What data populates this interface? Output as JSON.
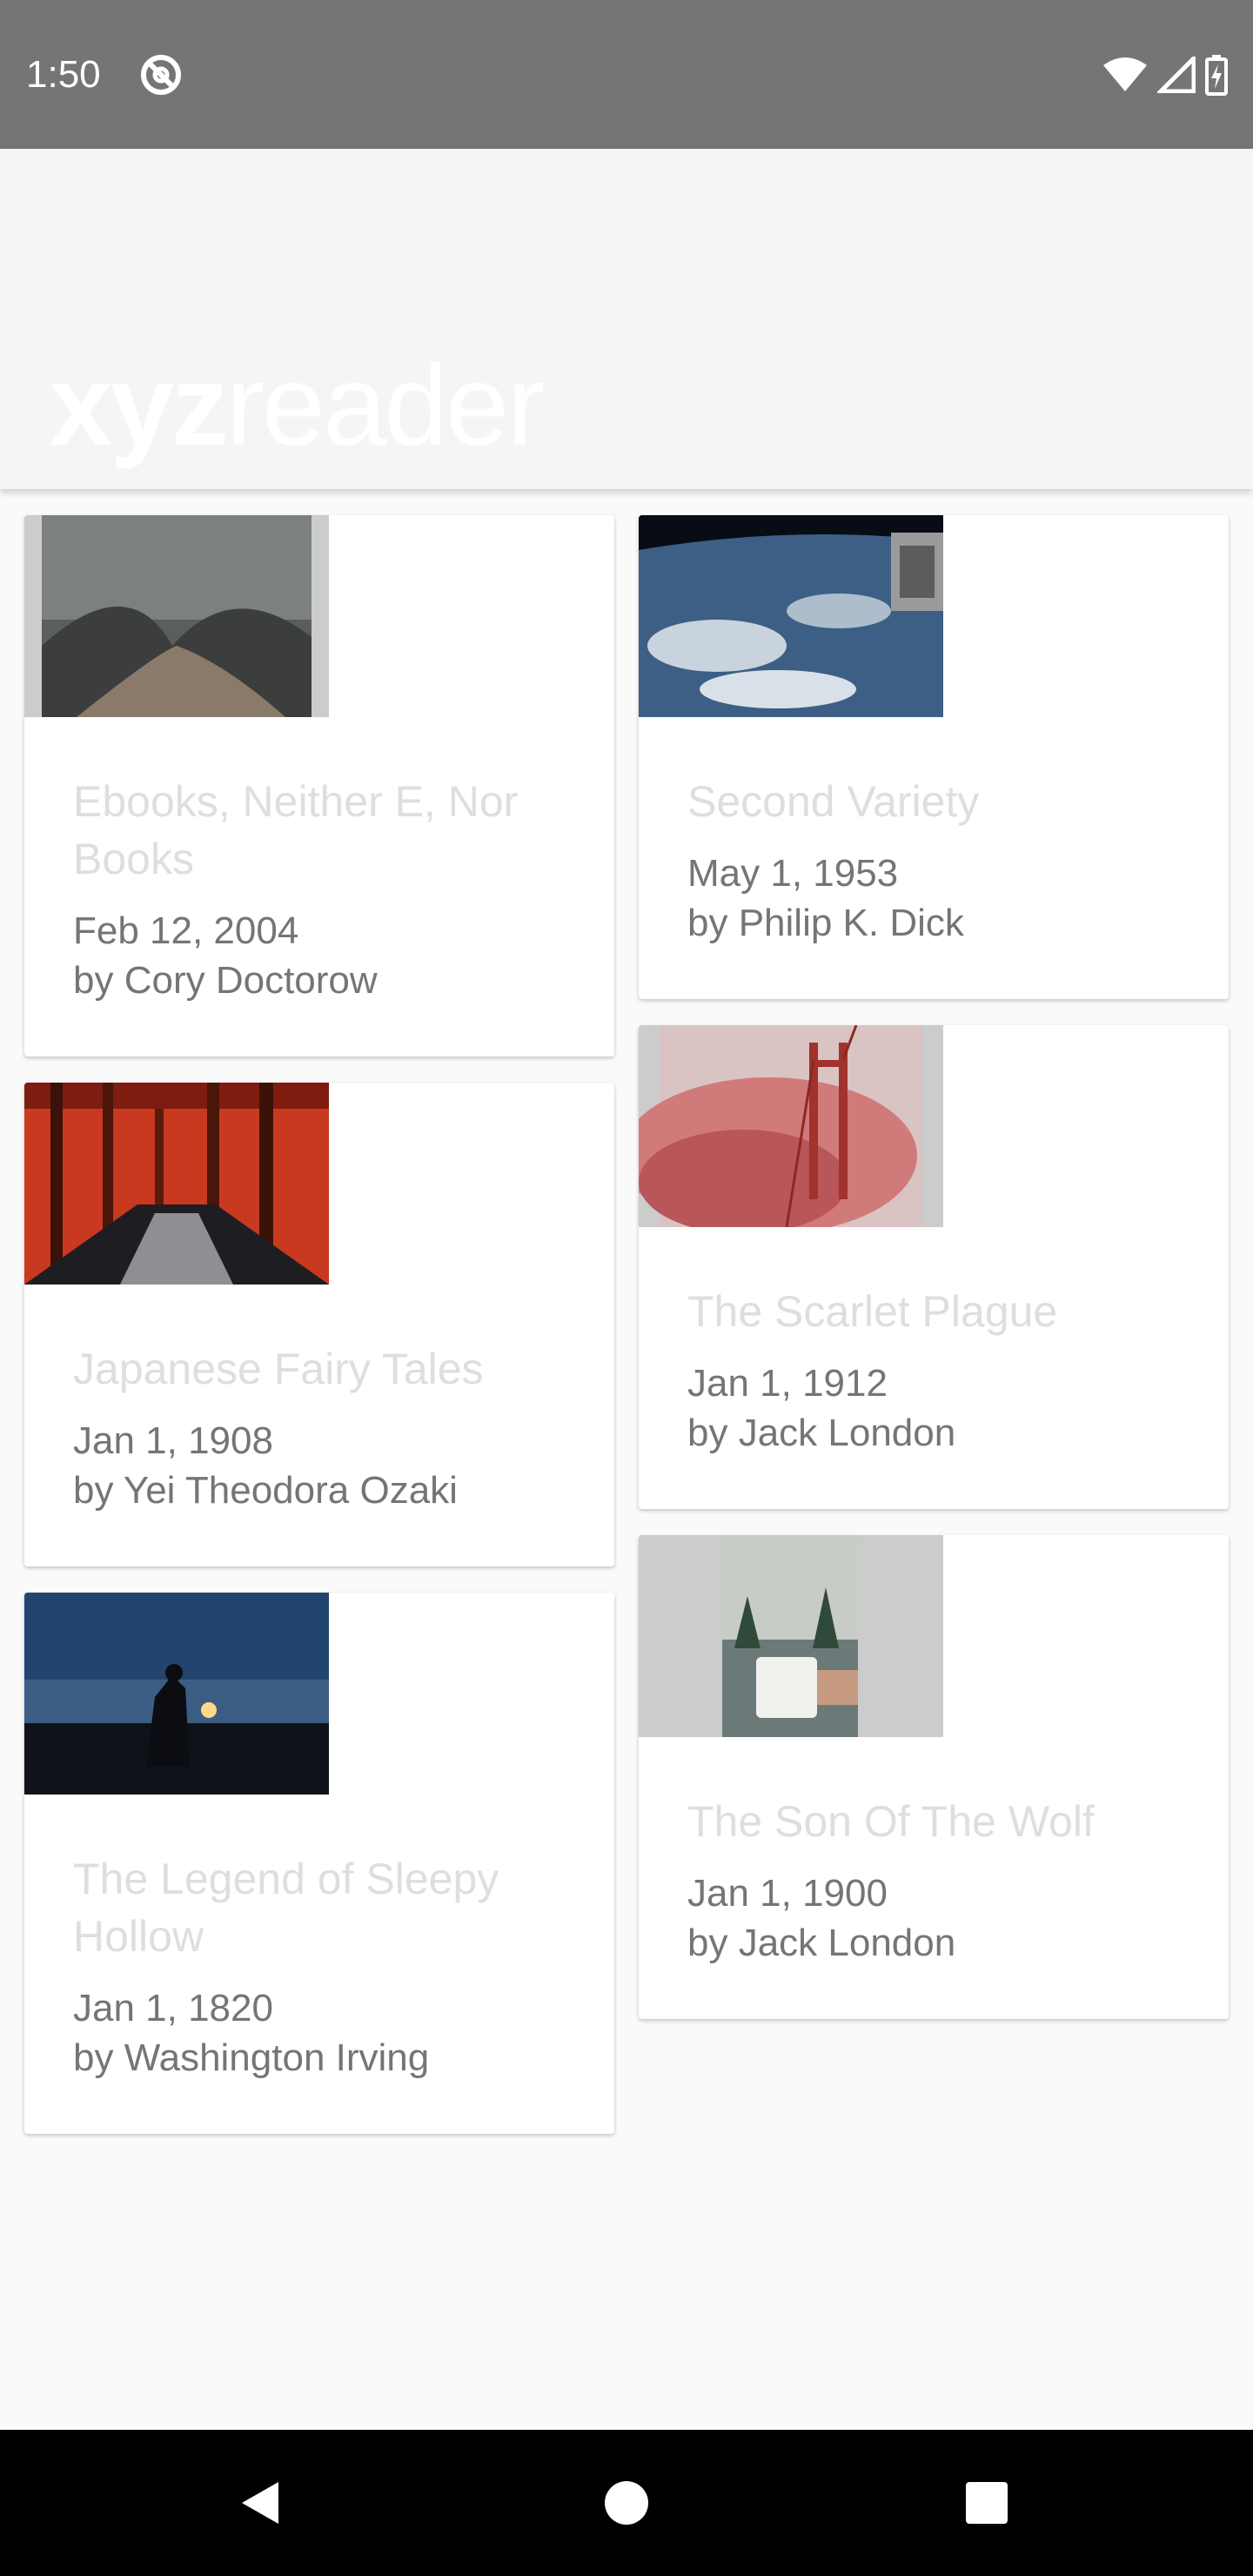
{
  "status_bar": {
    "time": "1:50",
    "notification_icon": "at-sign-icon",
    "wifi_icon": "wifi-icon",
    "signal_icon": "cell-signal-icon",
    "battery_icon": "battery-charging-icon"
  },
  "app_bar": {
    "logo_bold": "xyz",
    "logo_light": "reader"
  },
  "articles": [
    {
      "title": "Ebooks, Neither E, Nor Books",
      "date": "Feb 12, 2004",
      "author": "by Cory Doctorow"
    },
    {
      "title": "Second Variety",
      "date": "May 1, 1953",
      "author": "by Philip K. Dick"
    },
    {
      "title": "Japanese Fairy Tales",
      "date": "Jan 1, 1908",
      "author": "by Yei Theodora Ozaki"
    },
    {
      "title": "The Scarlet Plague",
      "date": "Jan 1, 1912",
      "author": "by Jack London"
    },
    {
      "title": "The Legend of Sleepy Hollow",
      "date": "Jan 1, 1820",
      "author": "by Washington Irving"
    },
    {
      "title": "The Son Of The Wolf",
      "date": "Jan 1, 1900",
      "author": "by Jack London"
    }
  ],
  "nav_bar": {
    "back_icon": "back-triangle-icon",
    "home_icon": "home-circle-icon",
    "recents_icon": "recents-square-icon"
  },
  "colors": {
    "status_bar": "#757575",
    "app_bar": "#f5f5f5",
    "page_background": "#fafafa",
    "card_title": "#dedede",
    "card_meta": "#757575"
  }
}
